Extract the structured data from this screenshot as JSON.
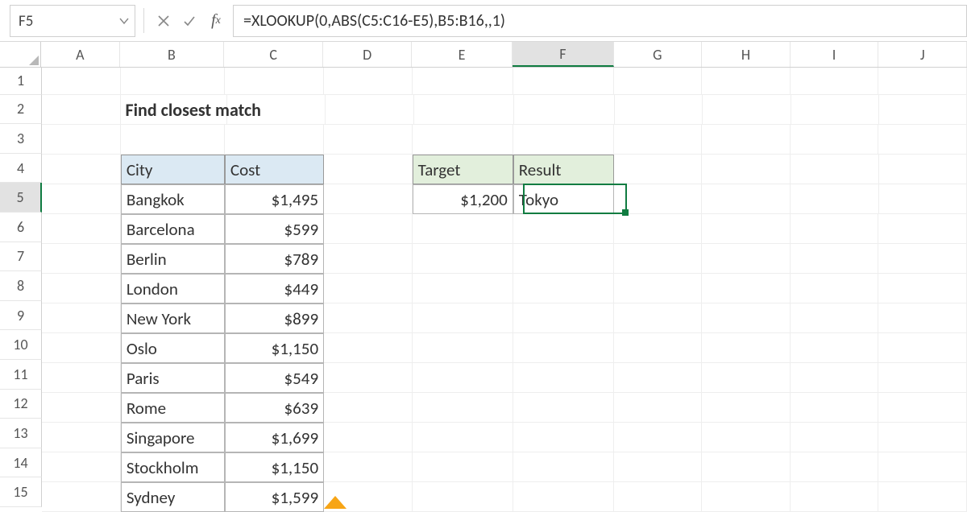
{
  "name_box": "F5",
  "formula": "=XLOOKUP(0,ABS(C5:C16-E5),B5:B16,,1)",
  "columns": [
    "A",
    "B",
    "C",
    "D",
    "E",
    "F",
    "G",
    "H",
    "I",
    "J"
  ],
  "selected_col_index": 5,
  "rows": [
    "1",
    "2",
    "3",
    "4",
    "5",
    "6",
    "7",
    "8",
    "9",
    "10",
    "11",
    "12",
    "13",
    "14",
    "15"
  ],
  "selected_row_index": 4,
  "title": "Find closest match",
  "table1": {
    "headers": {
      "city": "City",
      "cost": "Cost"
    },
    "rows": [
      {
        "city": "Bangkok",
        "cost": "$1,495"
      },
      {
        "city": "Barcelona",
        "cost": "$599"
      },
      {
        "city": "Berlin",
        "cost": "$789"
      },
      {
        "city": "London",
        "cost": "$449"
      },
      {
        "city": "New York",
        "cost": "$899"
      },
      {
        "city": "Oslo",
        "cost": "$1,150"
      },
      {
        "city": "Paris",
        "cost": "$549"
      },
      {
        "city": "Rome",
        "cost": "$639"
      },
      {
        "city": "Singapore",
        "cost": "$1,699"
      },
      {
        "city": "Stockholm",
        "cost": "$1,150"
      },
      {
        "city": "Sydney",
        "cost": "$1,599"
      }
    ]
  },
  "table2": {
    "headers": {
      "target": "Target",
      "result": "Result"
    },
    "target": "$1,200",
    "result": "Tokyo"
  },
  "row_heights": {
    "r1": 34,
    "default": 37
  }
}
